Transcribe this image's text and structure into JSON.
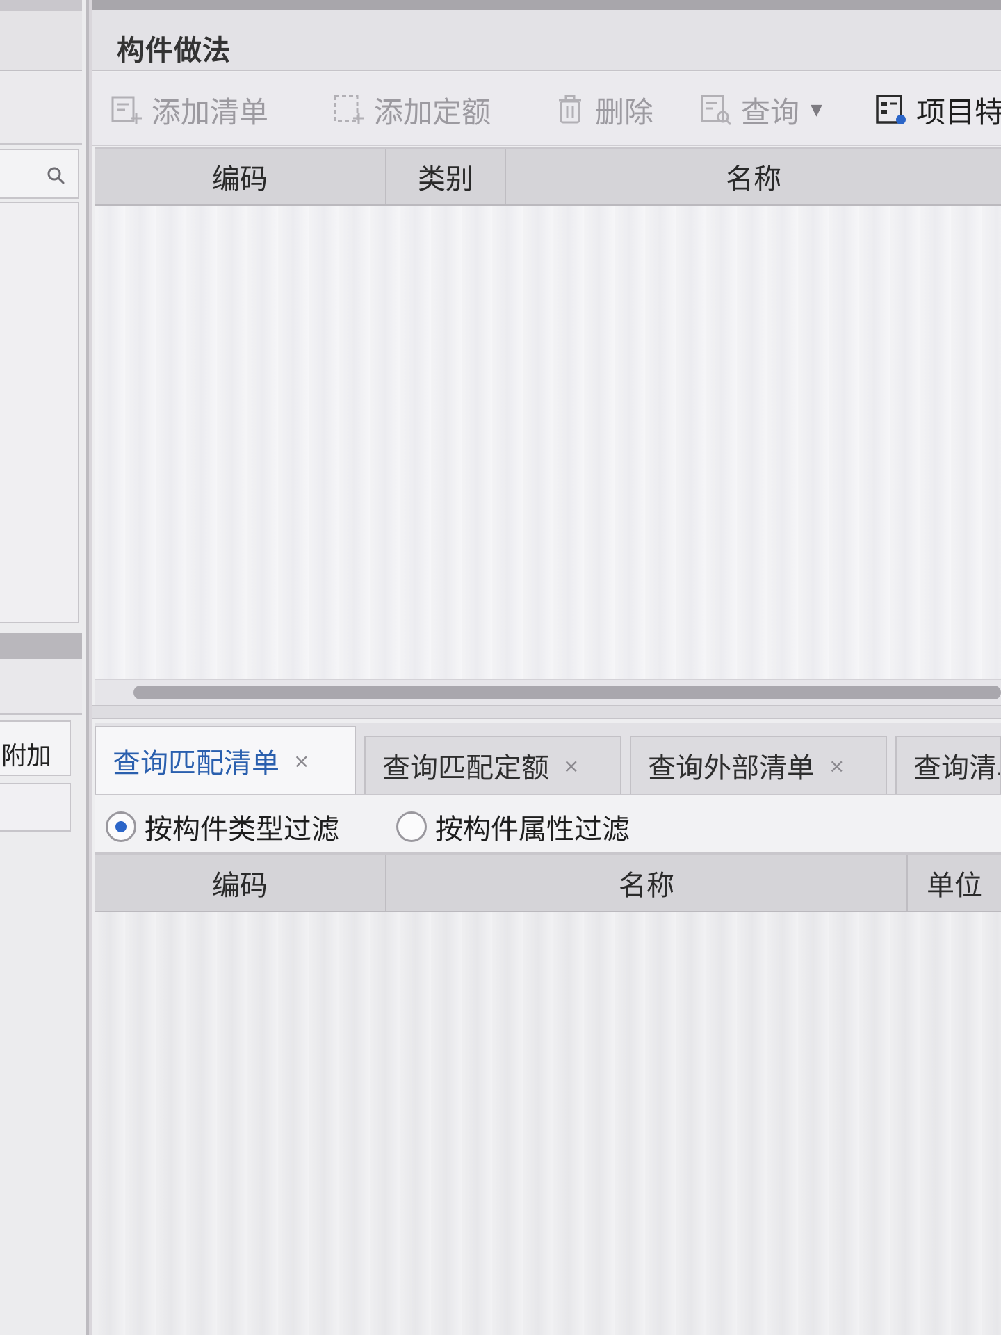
{
  "panel": {
    "title": "构件做法"
  },
  "toolbar": {
    "add_list": "添加清单",
    "add_quota": "添加定额",
    "delete": "删除",
    "query": "查询",
    "project": "项目特"
  },
  "top_table": {
    "columns": [
      "编码",
      "类别",
      "名称"
    ]
  },
  "tabs": [
    {
      "label": "查询匹配清单",
      "close": "×"
    },
    {
      "label": "查询匹配定额",
      "close": "×"
    },
    {
      "label": "查询外部清单",
      "close": "×"
    },
    {
      "label": "查询清单"
    }
  ],
  "filters": {
    "by_type": "按构件类型过滤",
    "by_attr": "按构件属性过滤",
    "selected": "by_type"
  },
  "bottom_table": {
    "columns": [
      "编码",
      "名称",
      "单位"
    ]
  },
  "left_panel": {
    "tab_label": "附加"
  },
  "colors": {
    "accent": "#2a5fae",
    "radio": "#2b65c8",
    "disabled_text": "#9c9aa0"
  }
}
